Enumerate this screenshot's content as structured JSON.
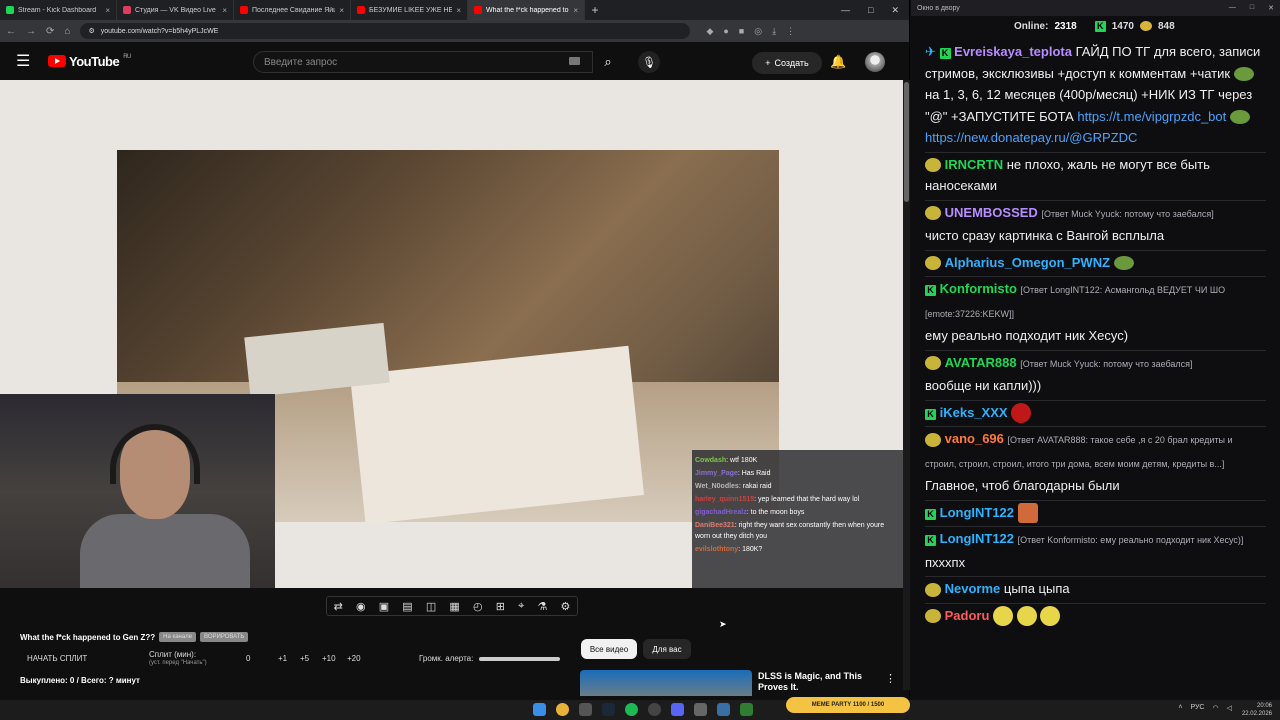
{
  "browser": {
    "tabs": [
      {
        "title": "Stream - Kick Dashboard",
        "color": "#1fd655"
      },
      {
        "title": "Студия — VK Видео Live",
        "color": "#e03b5b"
      },
      {
        "title": "Последнее Свидание Яйцесах",
        "color": "#ff0000"
      },
      {
        "title": "БЕЗУМИЕ LIKEE УЖЕ НЕ ОСТАНОВ",
        "color": "#ff0000"
      },
      {
        "title": "What the f*ck happened to",
        "color": "#ff0000"
      }
    ],
    "url": "youtube.com/watch?v=b5h4yPLJcWE"
  },
  "youtube": {
    "region": "RU",
    "logo_text": "YouTube",
    "search_placeholder": "Введите запрос",
    "create_label": "Создать",
    "video_title": "What the f*ck happened to Gen Z??",
    "chip1": "На канале",
    "chip2": "ВОРИРОВАТЬ",
    "split_start": "НАЧАТЬ СПЛИТ",
    "split_label": "Сплит (мин):",
    "split_hint": "(уст. перед \"Начать\")",
    "split_value": "0",
    "split_btns": [
      "+1",
      "+5",
      "+10",
      "+20"
    ],
    "alert_volume": "Громк. алерта:",
    "tally": "Выкуплено: 0 / Всего: ? минут",
    "tab_all": "Все видео",
    "tab_for_you": "Для вас",
    "rec_title": "DLSS is Magic, and This Proves It."
  },
  "video_chat": [
    {
      "user": "Cowdash",
      "color": "#7ec64c",
      "text": "wtf 180K"
    },
    {
      "user": "Jimmy_Page",
      "color": "#8a6fd1",
      "text": "Has Raid"
    },
    {
      "user": "Wet_N0odles",
      "color": "#b8b8b8",
      "text": "rakai raid"
    },
    {
      "user": "harley_quinn1515",
      "color": "#d04040",
      "text": "yep learned that the hard way lol"
    },
    {
      "user": "gigachadHrealz",
      "color": "#8060d0",
      "text": "to the moon boys"
    },
    {
      "user": "DaniBee321",
      "color": "#e07a6a",
      "text": "right they want sex constantly then when youre worn out they ditch you"
    },
    {
      "user": "evilslothtony",
      "color": "#d06a3a",
      "text": "180K?"
    }
  ],
  "chat": {
    "window_title": "Окно в двору",
    "online_label": "Online:",
    "online": "2318",
    "kick_count": "1470",
    "vk_count": "848",
    "pinned": {
      "user": "Evreiskaya_teplota",
      "text": "ГАЙД ПО ТГ для всего, записи стримов, эксклюзивы +доступ к комментам +чатик",
      "text2": "на 1, 3, 6, 12 месяцев (400р/месяц) +НИК ИЗ ТГ через \"@\" +ЗАПУСТИТЕ БОТА",
      "link1": "https://t.me/vipgrpzdc_bot",
      "link2": "https://new.donatepay.ru/@GRPZDC"
    },
    "messages": [
      {
        "user": "IRNCRTN",
        "color": "#1fd655",
        "reply": "",
        "text": "не плохо, жаль не могут все быть наносеками"
      },
      {
        "user": "UNEMBOSSED",
        "color": "#b98cff",
        "reply": "[Ответ Muck Yyuck: потому что заебался]",
        "text": "чисто сразу картинка с Вангой всплыла"
      },
      {
        "user": "Alpharius_Omegon_PWNZ",
        "color": "#2eb2ff",
        "reply": "",
        "text": ""
      },
      {
        "user": "Konformisto",
        "color": "#1fd655",
        "reply": "[Ответ LongINT122: Асмангольд ВЕДУЕТ ЧИ ШО [emote:37226:KEKW]]",
        "text": "ему реально подходит ник Хесус)"
      },
      {
        "user": "AVATAR888",
        "color": "#1fd655",
        "reply": "[Ответ Muck Yyuck: потому что заебался]",
        "text": "вообще ни капли)))"
      },
      {
        "user": "iKeks_XXX",
        "color": "#2eb2ff",
        "reply": "",
        "text": ""
      },
      {
        "user": "vano_696",
        "color": "#ff7a3a",
        "reply": "[Ответ AVATAR888: такое себе ,я с 20 брал кредиты и строил, строил, строил, итого три дома, всем моим детям, кредиты в...]",
        "text": "Главное, чтоб благодарны были"
      },
      {
        "user": "LongINT122",
        "color": "#2eb2ff",
        "reply": "",
        "text": ""
      },
      {
        "user": "LongINT122",
        "color": "#2eb2ff",
        "reply": "[Ответ Konformisto: ему реально подходит ник Хесус)]",
        "text": "пхххпх"
      },
      {
        "user": "Nevorme",
        "color": "#2eb2ff",
        "reply": "",
        "text": "цыпа цыпа"
      },
      {
        "user": "Padoru",
        "color": "#ff5a5a",
        "reply": "",
        "text": ""
      }
    ]
  },
  "taskbar": {
    "meme_widget": "MEME PARTY 1100 / 1500",
    "lang": "РУС",
    "time": "20:06",
    "date": "22.02.2026"
  }
}
